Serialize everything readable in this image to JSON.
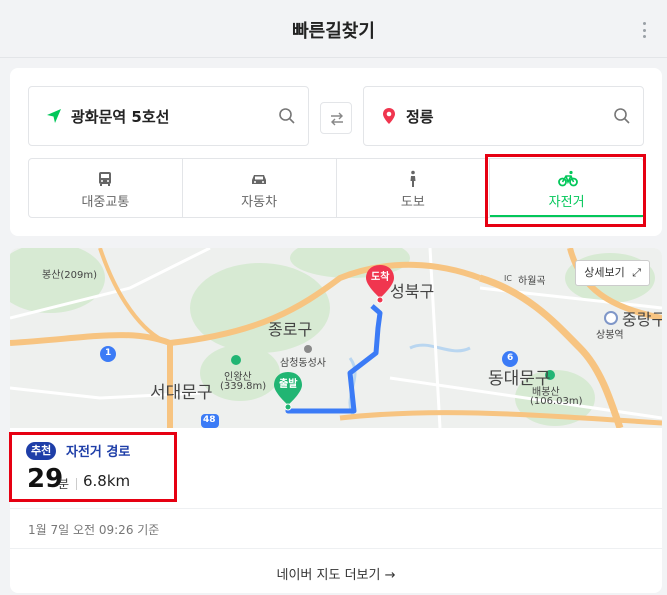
{
  "header": {
    "title": "빠른길찾기"
  },
  "search": {
    "origin": "광화문역 5호선",
    "destination": "정릉"
  },
  "modes": [
    {
      "label": "대중교통",
      "icon": "bus-icon",
      "active": false
    },
    {
      "label": "자동차",
      "icon": "car-icon",
      "active": false
    },
    {
      "label": "도보",
      "icon": "walk-icon",
      "active": false
    },
    {
      "label": "자전거",
      "icon": "bicycle-icon",
      "active": true
    }
  ],
  "map": {
    "detail_button": "상세보기",
    "start_marker": "출발",
    "end_marker": "도착",
    "labels": {
      "bongsan": "봉산(209m)",
      "jongno": "종로구",
      "seongbuk": "성북구",
      "samcheong": "삼청동성사",
      "inwangsan": "인왕산",
      "inwangsan_height": "(339.8m)",
      "seodaemun": "서대문구",
      "dongdaemun": "동대문구",
      "baebongsan": "배봉산",
      "baebongsan_height": "(106.03m)",
      "jungnang": "중랑구",
      "sangbong": "상봉역",
      "hawolgok": "하월곡",
      "ic": "IC",
      "route_1": "1",
      "route_6": "6",
      "route_48": "48"
    }
  },
  "route": {
    "badge": "추천",
    "title": "자전거 경로",
    "time": "29",
    "time_unit": "분",
    "distance": "6.8km",
    "basis": "1월 7일 오전 09:26 기준",
    "more": "네이버 지도 더보기 →"
  },
  "colors": {
    "accent_green": "#03c75a",
    "route_blue": "#1e3ea8",
    "route_line": "#3b7bf6",
    "highlight_red": "#e60012",
    "end_marker": "#f0364f",
    "start_marker": "#21b573"
  }
}
